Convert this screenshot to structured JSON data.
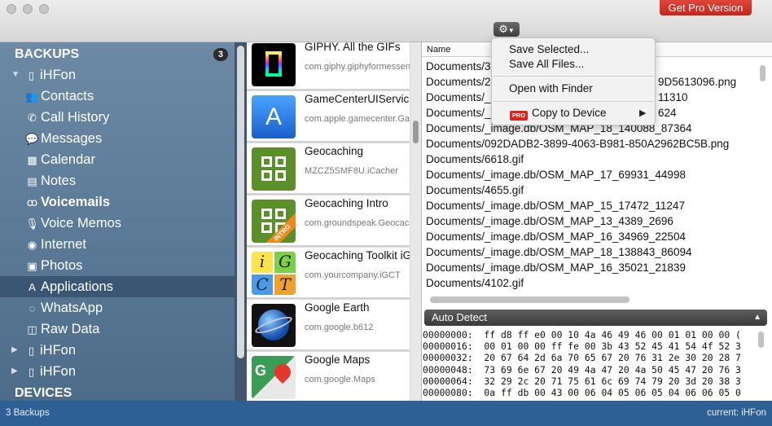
{
  "toolbar": {
    "pro_label": "Get Pro Version",
    "gear_icon": "gear-icon"
  },
  "menu": {
    "items": [
      "Save Selected...",
      "Save All Files...",
      "Open with Finder",
      "Copy to Device"
    ],
    "pro_tag": "PRO",
    "submenu_arrow": "▶"
  },
  "sidebar": {
    "backups_title": "BACKUPS",
    "backups_count": "3",
    "devices_title": "DEVICES",
    "items": [
      {
        "label": "iHFon",
        "icon": "phone-icon",
        "glyph": "▯",
        "type": "device",
        "expanded": true
      },
      {
        "label": "Contacts",
        "icon": "contacts-icon",
        "glyph": "👥",
        "type": "child"
      },
      {
        "label": "Call History",
        "icon": "call-icon",
        "glyph": "✆",
        "type": "child"
      },
      {
        "label": "Messages",
        "icon": "messages-icon",
        "glyph": "💬",
        "type": "child"
      },
      {
        "label": "Calendar",
        "icon": "calendar-icon",
        "glyph": "▦",
        "type": "child"
      },
      {
        "label": "Notes",
        "icon": "notes-icon",
        "glyph": "▤",
        "type": "child"
      },
      {
        "label": "Voicemails",
        "icon": "voicemail-icon",
        "glyph": "ꝏ",
        "type": "child",
        "bold": true
      },
      {
        "label": "Voice Memos",
        "icon": "microphone-icon",
        "glyph": "🎙",
        "type": "child"
      },
      {
        "label": "Internet",
        "icon": "globe-icon",
        "glyph": "◉",
        "type": "child"
      },
      {
        "label": "Photos",
        "icon": "photos-icon",
        "glyph": "▣",
        "type": "child"
      },
      {
        "label": "Applications",
        "icon": "applications-icon",
        "glyph": "A",
        "type": "child",
        "selected": true
      },
      {
        "label": "WhatsApp",
        "icon": "whatsapp-icon",
        "glyph": "◌",
        "type": "child"
      },
      {
        "label": "Raw Data",
        "icon": "raw-data-icon",
        "glyph": "◫",
        "type": "child"
      },
      {
        "label": "iHFon",
        "icon": "phone-icon",
        "glyph": "▯",
        "type": "device",
        "expanded": false
      },
      {
        "label": "iHFon",
        "icon": "phone-icon",
        "glyph": "▯",
        "type": "device",
        "expanded": false
      }
    ]
  },
  "apps": [
    {
      "name": "GIPHY. All the GIFs",
      "id": "com.giphy.giphyformessen",
      "icon": "giphy-icon"
    },
    {
      "name": "GameCenterUIServic",
      "id": "com.apple.gamecenter.Gam",
      "icon": "app-store-icon"
    },
    {
      "name": "Geocaching",
      "id": "MZCZ5SMF8U.iCacher",
      "icon": "geocaching-icon"
    },
    {
      "name": "Geocaching Intro",
      "id": "com.groundspeak.Geocacl",
      "icon": "geocaching-intro-icon",
      "ribbon": "INTRO"
    },
    {
      "name": "Geocaching Toolkit iG",
      "id": "com.yourcompany.iGCT",
      "icon": "geocaching-toolkit-icon",
      "letters": [
        "i",
        "G",
        "C",
        "T"
      ]
    },
    {
      "name": "Google Earth",
      "id": "com.google.b612",
      "icon": "google-earth-icon"
    },
    {
      "name": "Google Maps",
      "id": "com.google.Maps",
      "icon": "google-maps-icon",
      "letter": "G"
    }
  ],
  "files": {
    "header": "Name",
    "rows": [
      "Documents/3",
      "Documents/2",
      "Documents/_",
      "Documents/_",
      "Documents/_image.db/OSM_MAP_18_140088_87364",
      "Documents/092DADB2-3899-4063-B981-850A2962BC5B.png",
      "Documents/6618.gif",
      "Documents/_image.db/OSM_MAP_17_69931_44998",
      "Documents/4655.gif",
      "Documents/_image.db/OSM_MAP_15_17472_11247",
      "Documents/_image.db/OSM_MAP_13_4389_2696",
      "Documents/_image.db/OSM_MAP_16_34969_22504",
      "Documents/_image.db/OSM_MAP_18_138843_86094",
      "Documents/_image.db/OSM_MAP_16_35021_21839",
      "Documents/4102.gif"
    ],
    "row_tails": [
      {
        "row": 1,
        "text": "9D5613096.png"
      },
      {
        "row": 2,
        "text": "11310"
      },
      {
        "row": 3,
        "text": "624"
      }
    ]
  },
  "hex": {
    "mode": "Auto Detect",
    "lines": [
      "00000000:  ff d8 ff e0 00 10 4a 46 49 46 00 01 01 00 00 (",
      "00000016:  00 01 00 00 ff fe 00 3b 43 52 45 41 54 4f 52 3",
      "00000032:  20 67 64 2d 6a 70 65 67 20 76 31 2e 30 20 28 7",
      "00000048:  73 69 6e 67 20 49 4a 47 20 4a 50 45 47 20 76 3",
      "00000064:  32 29 2c 20 71 75 61 6c 69 74 79 20 3d 20 38 3",
      "00000080:  0a ff db 00 43 00 06 04 05 06 05 04 06 06 05 0"
    ]
  },
  "status": {
    "left": "3 Backups",
    "right": "current: iHFon"
  }
}
